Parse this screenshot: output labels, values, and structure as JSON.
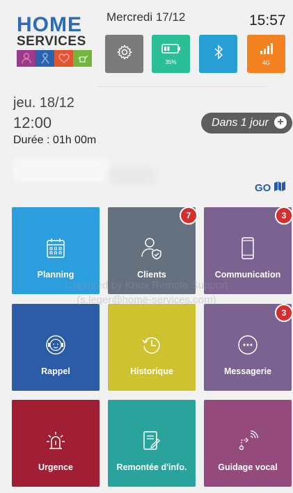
{
  "logo": {
    "line1": "HOME",
    "line2": "SERVICES"
  },
  "header": {
    "date": "Mercredi 17/12",
    "time": "15:57"
  },
  "status": {
    "settings_icon": "gear-icon",
    "battery_label": "35%",
    "bluetooth_icon": "bluetooth-icon",
    "signal_label": "4G",
    "colors": {
      "settings": "#7b7b7b",
      "battery": "#2bbf98",
      "bluetooth": "#2a9fd6",
      "signal": "#f58220"
    }
  },
  "appointment": {
    "day": "jeu. 18/12",
    "time": "12:00",
    "duration": "Durée : 01h 00m",
    "countdown": "Dans 1 jour",
    "plus": "+",
    "go": "GO"
  },
  "tiles": [
    {
      "label": "Planning",
      "color": "#2c9ede",
      "icon": "calendar-icon"
    },
    {
      "label": "Clients",
      "color": "#66717f",
      "icon": "user-shield-icon",
      "badge": "7"
    },
    {
      "label": "Communication",
      "color": "#7a6391",
      "icon": "smartphone-icon",
      "badge": "3"
    },
    {
      "label": "Rappel",
      "color": "#2c5ba8",
      "icon": "headset-icon"
    },
    {
      "label": "Historique",
      "color": "#cfc231",
      "icon": "history-icon"
    },
    {
      "label": "Messagerie",
      "color": "#7a6391",
      "icon": "chat-icon",
      "badge": "3"
    },
    {
      "label": "Urgence",
      "color": "#a11f35",
      "icon": "alarm-icon"
    },
    {
      "label": "Remontée d'info.",
      "color": "#2aa39c",
      "icon": "edit-document-icon"
    },
    {
      "label": "Guidage vocal",
      "color": "#944b7b",
      "icon": "voice-guidance-icon"
    }
  ],
  "watermark": {
    "line1": "Captured by Knox Remote Support",
    "line2": "(s.leger@home-services.com)"
  }
}
